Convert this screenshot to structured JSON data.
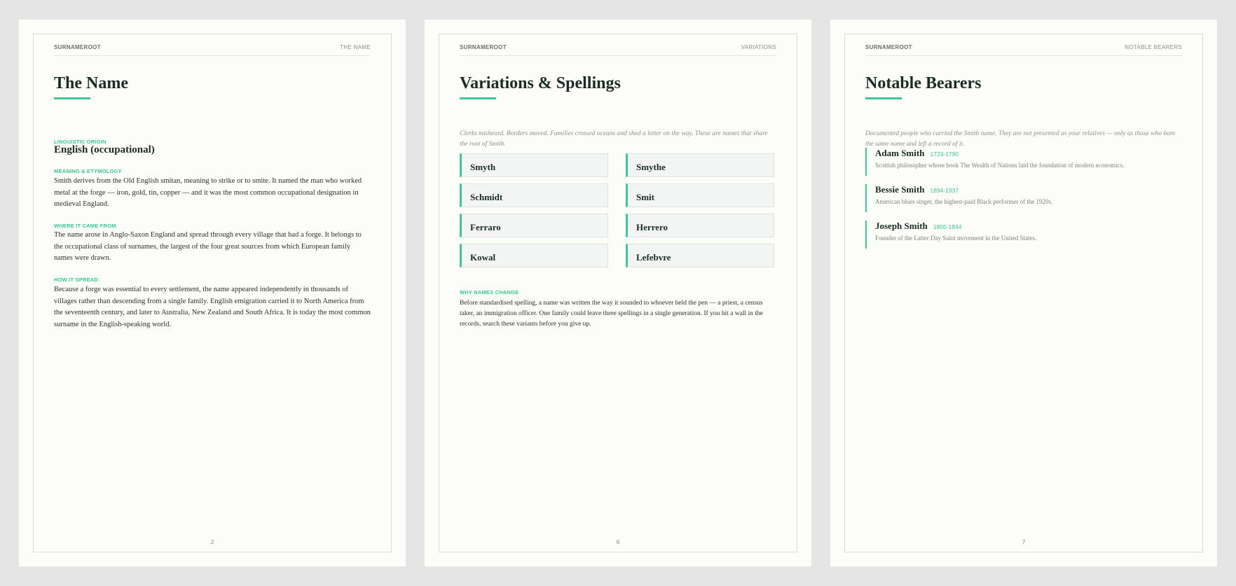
{
  "pages": [
    {
      "brand": "SURNAMEROOT",
      "section": "THE NAME",
      "title": "The Name",
      "origin_label": "LINGUISTIC ORIGIN",
      "origin_value": "English (occupational)",
      "meaning_label": "MEANING & ETYMOLOGY",
      "meaning_text": "Smith derives from the Old English smitan, meaning to strike or to smite. It named the man who worked metal at the forge — iron, gold, tin, copper — and it was the most common occupational designation in medieval England.",
      "origin_place_label": "WHERE IT CAME FROM",
      "origin_place_text": "The name arose in Anglo-Saxon England and spread through every village that had a forge. It belongs to the occupational class of surnames, the largest of the four great sources from which European family names were drawn.",
      "spread_label": "HOW IT SPREAD",
      "spread_text": "Because a forge was essential to every settlement, the name appeared independently in thousands of villages rather than descending from a single family. English emigration carried it to North America from the seventeenth century, and later to Australia, New Zealand and South Africa. It is today the most common surname in the English-speaking world.",
      "page_number": "2"
    },
    {
      "brand": "SURNAMEROOT",
      "section": "VARIATIONS",
      "title": "Variations & Spellings",
      "lede": "Clerks misheard. Borders moved. Families crossed oceans and shed a letter on the way. These are names that share the root of Smith.",
      "variants": [
        "Smyth",
        "Smythe",
        "Schmidt",
        "Smit",
        "Ferraro",
        "Herrero",
        "Kowal",
        "Lefebvre"
      ],
      "why_label": "WHY NAMES CHANGE",
      "why_text": "Before standardised spelling, a name was written the way it sounded to whoever held the pen — a priest, a census taker, an immigration officer. One family could leave three spellings in a single generation. If you hit a wall in the records, search these variants before you give up.",
      "page_number": "6"
    },
    {
      "brand": "SURNAMEROOT",
      "section": "NOTABLE BEARERS",
      "title": "Notable Bearers",
      "lede": "Documented people who carried the Smith name. They are not presented as your relatives — only as those who bore the same name and left a record of it.",
      "bearers": [
        {
          "name": "Adam Smith",
          "years": "1723-1790",
          "desc": "Scottish philosopher whose book The Wealth of Nations laid the foundation of modern economics."
        },
        {
          "name": "Bessie Smith",
          "years": "1894-1937",
          "desc": "American blues singer, the highest-paid Black performer of the 1920s."
        },
        {
          "name": "Joseph Smith",
          "years": "1805-1844",
          "desc": "Founder of the Latter Day Saint movement in the United States."
        }
      ],
      "page_number": "7"
    }
  ]
}
